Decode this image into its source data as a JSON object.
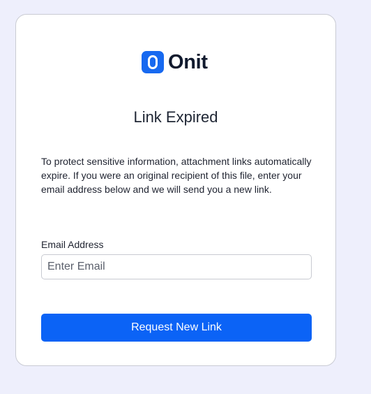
{
  "brand": {
    "name": "Onit",
    "accent_color": "#1769f0",
    "logo_icon": "onit-logo-icon"
  },
  "page": {
    "title": "Link Expired",
    "description": "To protect sensitive information, attachment links automatically expire. If you were an original recipient of this file, enter your email address below and we will send you a new link."
  },
  "form": {
    "email_label": "Email Address",
    "email_placeholder": "Enter Email",
    "email_value": "",
    "submit_label": "Request New Link",
    "button_color": "#0b63f6"
  }
}
